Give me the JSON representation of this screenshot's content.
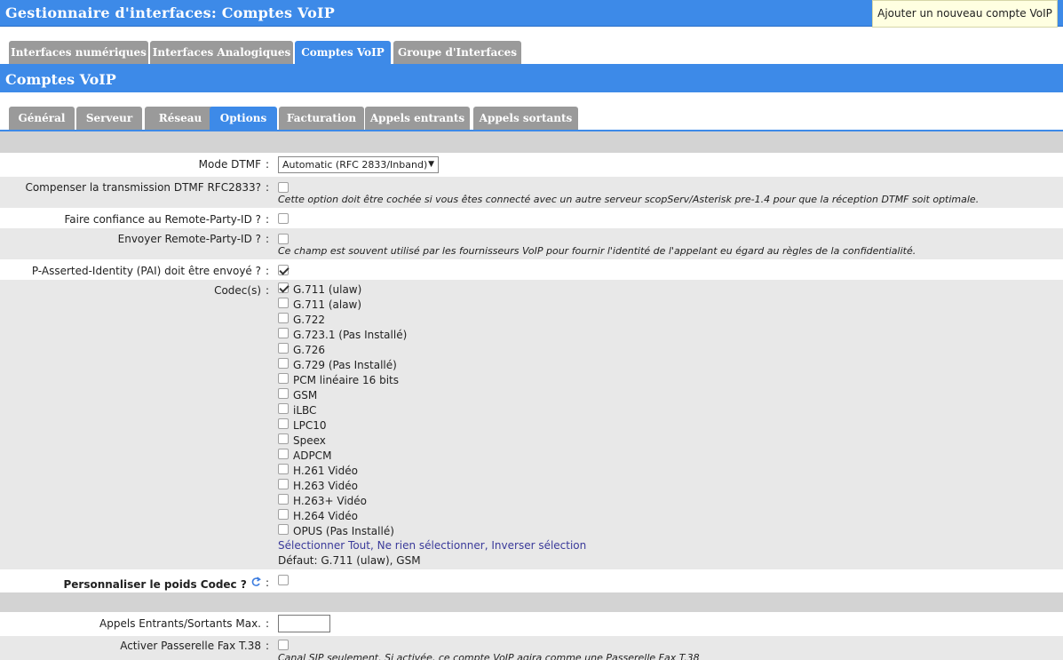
{
  "header": {
    "title": "Gestionnaire d'interfaces:  Comptes VoIP",
    "add_button": "Ajouter un nouveau compte VoIP"
  },
  "top_tabs": [
    {
      "label": "Interfaces numériques",
      "active": false
    },
    {
      "label": "Interfaces Analogiques",
      "active": false
    },
    {
      "label": "Comptes VoIP",
      "active": true
    },
    {
      "label": "Groupe d'Interfaces",
      "active": false
    }
  ],
  "section_title": "Comptes VoIP",
  "sub_tabs": [
    {
      "label": "Général",
      "active": false
    },
    {
      "label": "Serveur",
      "active": false
    },
    {
      "label": "Réseau",
      "active": false
    },
    {
      "label": "Options",
      "active": true
    },
    {
      "label": "Facturation",
      "active": false
    },
    {
      "label": "Appels entrants",
      "active": false
    },
    {
      "label": "Appels sortants",
      "active": false
    }
  ],
  "form": {
    "colon": ":",
    "dtmf_label": "Mode DTMF",
    "dtmf_value": "Automatic (RFC 2833/Inband)",
    "dtmf_arrow": "▼",
    "compensate_label": "Compenser la transmission DTMF RFC2833?",
    "compensate_checked": false,
    "compensate_hint": "Cette option doit être cochée si vous êtes connecté avec un autre serveur scopServ/Asterisk pre-1.4 pour que la réception DTMF soit optimale.",
    "trust_rpid_label": "Faire confiance au Remote-Party-ID ?",
    "trust_rpid_checked": false,
    "send_rpid_label": "Envoyer Remote-Party-ID ?",
    "send_rpid_checked": false,
    "send_rpid_hint": "Ce champ est souvent utilisé par les fournisseurs VoIP pour fournir l'identité de l'appelant eu égard au règles de la confidentialité.",
    "pai_label": "P-Asserted-Identity (PAI) doit être envoyé ?",
    "pai_checked": true,
    "codecs_label": "Codec(s)",
    "codecs": [
      {
        "name": "G.711 (ulaw)",
        "checked": true
      },
      {
        "name": "G.711 (alaw)",
        "checked": false
      },
      {
        "name": "G.722",
        "checked": false
      },
      {
        "name": "G.723.1 (Pas Installé)",
        "checked": false
      },
      {
        "name": "G.726",
        "checked": false
      },
      {
        "name": "G.729 (Pas Installé)",
        "checked": false
      },
      {
        "name": "PCM linéaire 16 bits",
        "checked": false
      },
      {
        "name": "GSM",
        "checked": false
      },
      {
        "name": "iLBC",
        "checked": false
      },
      {
        "name": "LPC10",
        "checked": false
      },
      {
        "name": "Speex",
        "checked": false
      },
      {
        "name": "ADPCM",
        "checked": false
      },
      {
        "name": "H.261 Vidéo",
        "checked": false
      },
      {
        "name": "H.263 Vidéo",
        "checked": false
      },
      {
        "name": "H.263+ Vidéo",
        "checked": false
      },
      {
        "name": "H.264 Vidéo",
        "checked": false
      },
      {
        "name": "OPUS (Pas Installé)",
        "checked": false
      }
    ],
    "select_all": "Sélectionner Tout",
    "select_none": "Ne rien sélectionner",
    "invert": "Inverser sélection",
    "link_sep": ", ",
    "codecs_default": "Défaut: G.711 (ulaw), GSM",
    "codec_weight_label": "Personnaliser le poids Codec ?",
    "codec_weight_checked": false,
    "max_calls_label": "Appels Entrants/Sortants Max.",
    "max_calls_value": "",
    "fax_label": "Activer Passerelle Fax T.38",
    "fax_checked": false,
    "fax_hint": "Canal SIP seulement. Si activée, ce compte VoIP agira comme une Passerelle Fax T.38"
  },
  "icons": {
    "refresh": "refresh-icon",
    "dropdown": "chevron-down-icon",
    "check": "checkmark"
  },
  "colors": {
    "accent": "#3d8ae8",
    "tab_inactive": "#9a9a9a",
    "row_gray": "#e8e8e8",
    "row_dark": "#d3d3d3",
    "button_bg": "#ffffe1",
    "link": "#3a3a9a"
  }
}
